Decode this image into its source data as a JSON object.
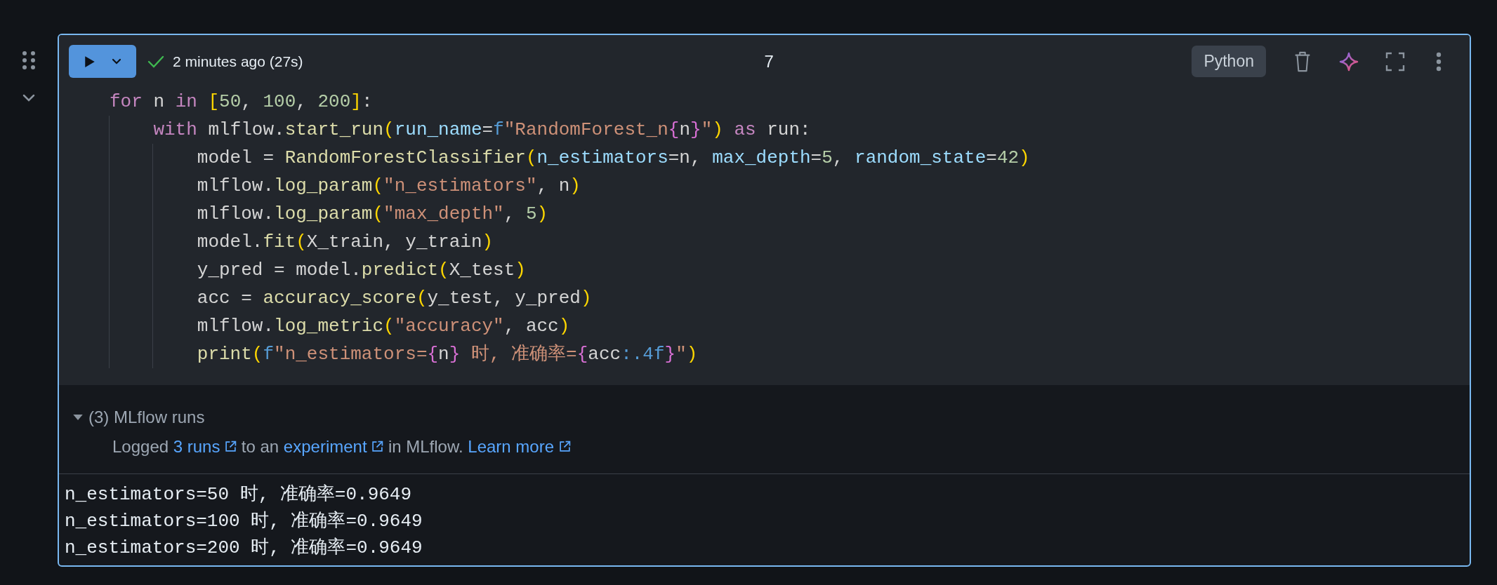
{
  "cell": {
    "focused": true,
    "succeeded": true,
    "status_text": "2 minutes ago (27s)",
    "execution_count": "7",
    "language": "Python",
    "code": [
      {
        "tokens": [
          {
            "t": "for",
            "kind": "kw"
          },
          {
            "t": " n ",
            "kind": "plain"
          },
          {
            "t": "in ",
            "kind": "kw"
          },
          {
            "t": "[",
            "kind": "b1"
          },
          {
            "t": "50",
            "kind": "num"
          },
          {
            "t": ", ",
            "kind": "plain"
          },
          {
            "t": "100",
            "kind": "num"
          },
          {
            "t": ", ",
            "kind": "plain"
          },
          {
            "t": "200",
            "kind": "num"
          },
          {
            "t": "]",
            "kind": "b1"
          },
          {
            "t": ":",
            "kind": "plain"
          }
        ],
        "children": [
          {
            "tokens": [
              {
                "t": "with",
                "kind": "kw"
              },
              {
                "t": " mlflow.",
                "kind": "plain"
              },
              {
                "t": "start_run",
                "kind": "fn"
              },
              {
                "t": "(",
                "kind": "b1"
              },
              {
                "t": "run_name",
                "kind": "param"
              },
              {
                "t": "=",
                "kind": "plain"
              },
              {
                "t": "f",
                "kind": "fpre"
              },
              {
                "t": "\"RandomForest_n",
                "kind": "str"
              },
              {
                "t": "{",
                "kind": "b2"
              },
              {
                "t": "n",
                "kind": "plain"
              },
              {
                "t": "}",
                "kind": "b2"
              },
              {
                "t": "\"",
                "kind": "str"
              },
              {
                "t": ")",
                "kind": "b1"
              },
              {
                "t": " as",
                "kind": "kw"
              },
              {
                "t": " run:",
                "kind": "plain"
              }
            ],
            "children": [
              {
                "tokens": [
                  {
                    "t": "model = ",
                    "kind": "plain"
                  },
                  {
                    "t": "RandomForestClassifier",
                    "kind": "fn"
                  },
                  {
                    "t": "(",
                    "kind": "b1"
                  },
                  {
                    "t": "n_estimators",
                    "kind": "param"
                  },
                  {
                    "t": "=n, ",
                    "kind": "plain"
                  },
                  {
                    "t": "max_depth",
                    "kind": "param"
                  },
                  {
                    "t": "=",
                    "kind": "plain"
                  },
                  {
                    "t": "5",
                    "kind": "num"
                  },
                  {
                    "t": ", ",
                    "kind": "plain"
                  },
                  {
                    "t": "random_state",
                    "kind": "param"
                  },
                  {
                    "t": "=",
                    "kind": "plain"
                  },
                  {
                    "t": "42",
                    "kind": "num"
                  },
                  {
                    "t": ")",
                    "kind": "b1"
                  }
                ]
              },
              {
                "tokens": [
                  {
                    "t": "mlflow.",
                    "kind": "plain"
                  },
                  {
                    "t": "log_param",
                    "kind": "fn"
                  },
                  {
                    "t": "(",
                    "kind": "b1"
                  },
                  {
                    "t": "\"n_estimators\"",
                    "kind": "str"
                  },
                  {
                    "t": ", n",
                    "kind": "plain"
                  },
                  {
                    "t": ")",
                    "kind": "b1"
                  }
                ]
              },
              {
                "tokens": [
                  {
                    "t": "mlflow.",
                    "kind": "plain"
                  },
                  {
                    "t": "log_param",
                    "kind": "fn"
                  },
                  {
                    "t": "(",
                    "kind": "b1"
                  },
                  {
                    "t": "\"max_depth\"",
                    "kind": "str"
                  },
                  {
                    "t": ", ",
                    "kind": "plain"
                  },
                  {
                    "t": "5",
                    "kind": "num"
                  },
                  {
                    "t": ")",
                    "kind": "b1"
                  }
                ]
              },
              {
                "tokens": [
                  {
                    "t": "model.",
                    "kind": "plain"
                  },
                  {
                    "t": "fit",
                    "kind": "fn"
                  },
                  {
                    "t": "(",
                    "kind": "b1"
                  },
                  {
                    "t": "X_train, y_train",
                    "kind": "plain"
                  },
                  {
                    "t": ")",
                    "kind": "b1"
                  }
                ]
              },
              {
                "tokens": [
                  {
                    "t": "y_pred = model.",
                    "kind": "plain"
                  },
                  {
                    "t": "predict",
                    "kind": "fn"
                  },
                  {
                    "t": "(",
                    "kind": "b1"
                  },
                  {
                    "t": "X_test",
                    "kind": "plain"
                  },
                  {
                    "t": ")",
                    "kind": "b1"
                  }
                ]
              },
              {
                "tokens": [
                  {
                    "t": "acc = ",
                    "kind": "plain"
                  },
                  {
                    "t": "accuracy_score",
                    "kind": "fn"
                  },
                  {
                    "t": "(",
                    "kind": "b1"
                  },
                  {
                    "t": "y_test, y_pred",
                    "kind": "plain"
                  },
                  {
                    "t": ")",
                    "kind": "b1"
                  }
                ]
              },
              {
                "tokens": [
                  {
                    "t": "mlflow.",
                    "kind": "plain"
                  },
                  {
                    "t": "log_metric",
                    "kind": "fn"
                  },
                  {
                    "t": "(",
                    "kind": "b1"
                  },
                  {
                    "t": "\"accuracy\"",
                    "kind": "str"
                  },
                  {
                    "t": ", acc",
                    "kind": "plain"
                  },
                  {
                    "t": ")",
                    "kind": "b1"
                  }
                ]
              },
              {
                "tokens": [
                  {
                    "t": "print",
                    "kind": "fn"
                  },
                  {
                    "t": "(",
                    "kind": "b1"
                  },
                  {
                    "t": "f",
                    "kind": "fpre"
                  },
                  {
                    "t": "\"n_estimators=",
                    "kind": "str"
                  },
                  {
                    "t": "{",
                    "kind": "b2"
                  },
                  {
                    "t": "n",
                    "kind": "plain"
                  },
                  {
                    "t": "}",
                    "kind": "b2"
                  },
                  {
                    "t": " 时, 准确率=",
                    "kind": "str"
                  },
                  {
                    "t": "{",
                    "kind": "b2"
                  },
                  {
                    "t": "acc",
                    "kind": "plain"
                  },
                  {
                    "t": ":.4f",
                    "kind": "fpre"
                  },
                  {
                    "t": "}",
                    "kind": "b2"
                  },
                  {
                    "t": "\"",
                    "kind": "str"
                  },
                  {
                    "t": ")",
                    "kind": "b1"
                  }
                ]
              }
            ]
          }
        ]
      }
    ],
    "mlflow": {
      "title": "(3) MLflow runs",
      "expanded": true,
      "message": [
        {
          "t": "Logged ",
          "link": false
        },
        {
          "t": "3 runs",
          "link": true
        },
        {
          "t": " to an ",
          "link": false
        },
        {
          "t": "experiment",
          "link": true
        },
        {
          "t": " in MLflow. ",
          "link": false
        },
        {
          "t": "Learn more",
          "link": true
        }
      ]
    },
    "stdout": [
      "n_estimators=50 时, 准确率=0.9649",
      "n_estimators=100 时, 准确率=0.9649",
      "n_estimators=200 时, 准确率=0.9649"
    ]
  }
}
